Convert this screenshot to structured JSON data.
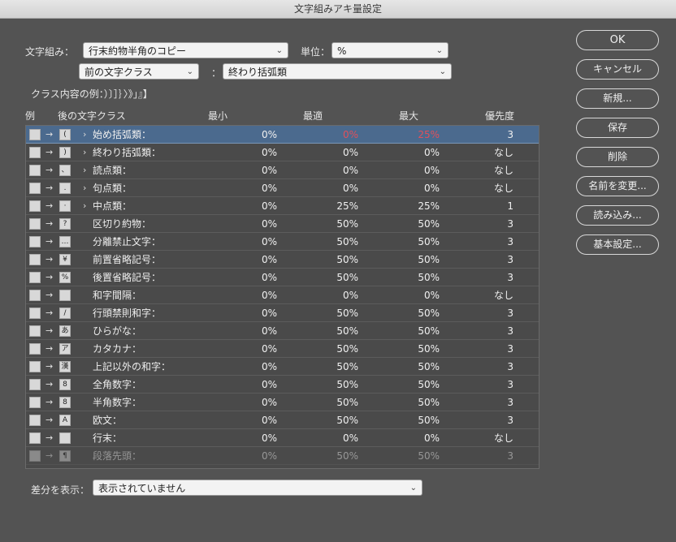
{
  "window": {
    "title": "文字組みアキ量設定"
  },
  "form": {
    "mojikumi_label": "文字組み：",
    "mojikumi_value": "行末約物半角のコピー",
    "unit_label": "単位：",
    "unit_value": "%",
    "prev_class_value": "前の文字クラス",
    "colon": "：",
    "class_value": "終わり括弧類",
    "example_text": "クラス内容の例：）〕］｝〉》」』】"
  },
  "table": {
    "headers": {
      "example": "例",
      "after_class": "後の文字クラス",
      "min": "最小",
      "optimal": "最適",
      "max": "最大",
      "priority": "優先度"
    },
    "rows": [
      {
        "icon": "open-bracket-icon",
        "glyph": "(",
        "expandable": "›",
        "name": "始め括弧類：",
        "min": "0%",
        "opt": "0%",
        "max": "25%",
        "pri": "3"
      },
      {
        "icon": "close-bracket-icon",
        "glyph": ")",
        "expandable": "›",
        "name": "終わり括弧類：",
        "min": "0%",
        "opt": "0%",
        "max": "0%",
        "pri": "なし"
      },
      {
        "icon": "comma-icon",
        "glyph": "、",
        "expandable": "›",
        "name": "読点類：",
        "min": "0%",
        "opt": "0%",
        "max": "0%",
        "pri": "なし"
      },
      {
        "icon": "period-icon",
        "glyph": ".",
        "expandable": "›",
        "name": "句点類：",
        "min": "0%",
        "opt": "0%",
        "max": "0%",
        "pri": "なし"
      },
      {
        "icon": "middle-dot-icon",
        "glyph": "·",
        "expandable": "›",
        "name": "中点類：",
        "min": "0%",
        "opt": "25%",
        "max": "25%",
        "pri": "1"
      },
      {
        "icon": "question-icon",
        "glyph": "?",
        "expandable": "",
        "name": "区切り約物：",
        "min": "0%",
        "opt": "50%",
        "max": "50%",
        "pri": "3"
      },
      {
        "icon": "ellipsis-icon",
        "glyph": "…",
        "expandable": "",
        "name": "分離禁止文字：",
        "min": "0%",
        "opt": "50%",
        "max": "50%",
        "pri": "3"
      },
      {
        "icon": "yen-icon",
        "glyph": "¥",
        "expandable": "",
        "name": "前置省略記号：",
        "min": "0%",
        "opt": "50%",
        "max": "50%",
        "pri": "3"
      },
      {
        "icon": "percent-icon",
        "glyph": "%",
        "expandable": "",
        "name": "後置省略記号：",
        "min": "0%",
        "opt": "50%",
        "max": "50%",
        "pri": "3"
      },
      {
        "icon": "space-icon",
        "glyph": "",
        "expandable": "",
        "name": "和字間隔：",
        "min": "0%",
        "opt": "0%",
        "max": "0%",
        "pri": "なし"
      },
      {
        "icon": "slash-icon",
        "glyph": "/",
        "expandable": "",
        "name": "行頭禁則和字：",
        "min": "0%",
        "opt": "50%",
        "max": "50%",
        "pri": "3"
      },
      {
        "icon": "hiragana-icon",
        "glyph": "あ",
        "expandable": "",
        "name": "ひらがな：",
        "min": "0%",
        "opt": "50%",
        "max": "50%",
        "pri": "3"
      },
      {
        "icon": "katakana-icon",
        "glyph": "ア",
        "expandable": "",
        "name": "カタカナ：",
        "min": "0%",
        "opt": "50%",
        "max": "50%",
        "pri": "3"
      },
      {
        "icon": "kanji-icon",
        "glyph": "漢",
        "expandable": "",
        "name": "上記以外の和字：",
        "min": "0%",
        "opt": "50%",
        "max": "50%",
        "pri": "3"
      },
      {
        "icon": "fullwidth-digit-icon",
        "glyph": "8",
        "expandable": "",
        "name": "全角数字：",
        "min": "0%",
        "opt": "50%",
        "max": "50%",
        "pri": "3"
      },
      {
        "icon": "halfwidth-digit-icon",
        "glyph": "8",
        "expandable": "",
        "name": "半角数字：",
        "min": "0%",
        "opt": "50%",
        "max": "50%",
        "pri": "3"
      },
      {
        "icon": "latin-icon",
        "glyph": "A",
        "expandable": "",
        "name": "欧文：",
        "min": "0%",
        "opt": "50%",
        "max": "50%",
        "pri": "3"
      },
      {
        "icon": "line-end-icon",
        "glyph": "",
        "expandable": "",
        "name": "行末：",
        "min": "0%",
        "opt": "0%",
        "max": "0%",
        "pri": "なし"
      },
      {
        "icon": "paragraph-icon",
        "glyph": "¶",
        "expandable": "",
        "name": "段落先頭：",
        "min": "0%",
        "opt": "50%",
        "max": "50%",
        "pri": "3"
      }
    ]
  },
  "buttons": {
    "ok": "OK",
    "cancel": "キャンセル",
    "new": "新規...",
    "save": "保存",
    "delete": "削除",
    "rename": "名前を変更...",
    "load": "読み込み...",
    "basic": "基本設定..."
  },
  "diff": {
    "label": "差分を表示：",
    "value": "表示されていません"
  },
  "colors": {
    "background": "#535353",
    "selection": "#4b6a8e",
    "highlight_red": "#e0505a"
  }
}
